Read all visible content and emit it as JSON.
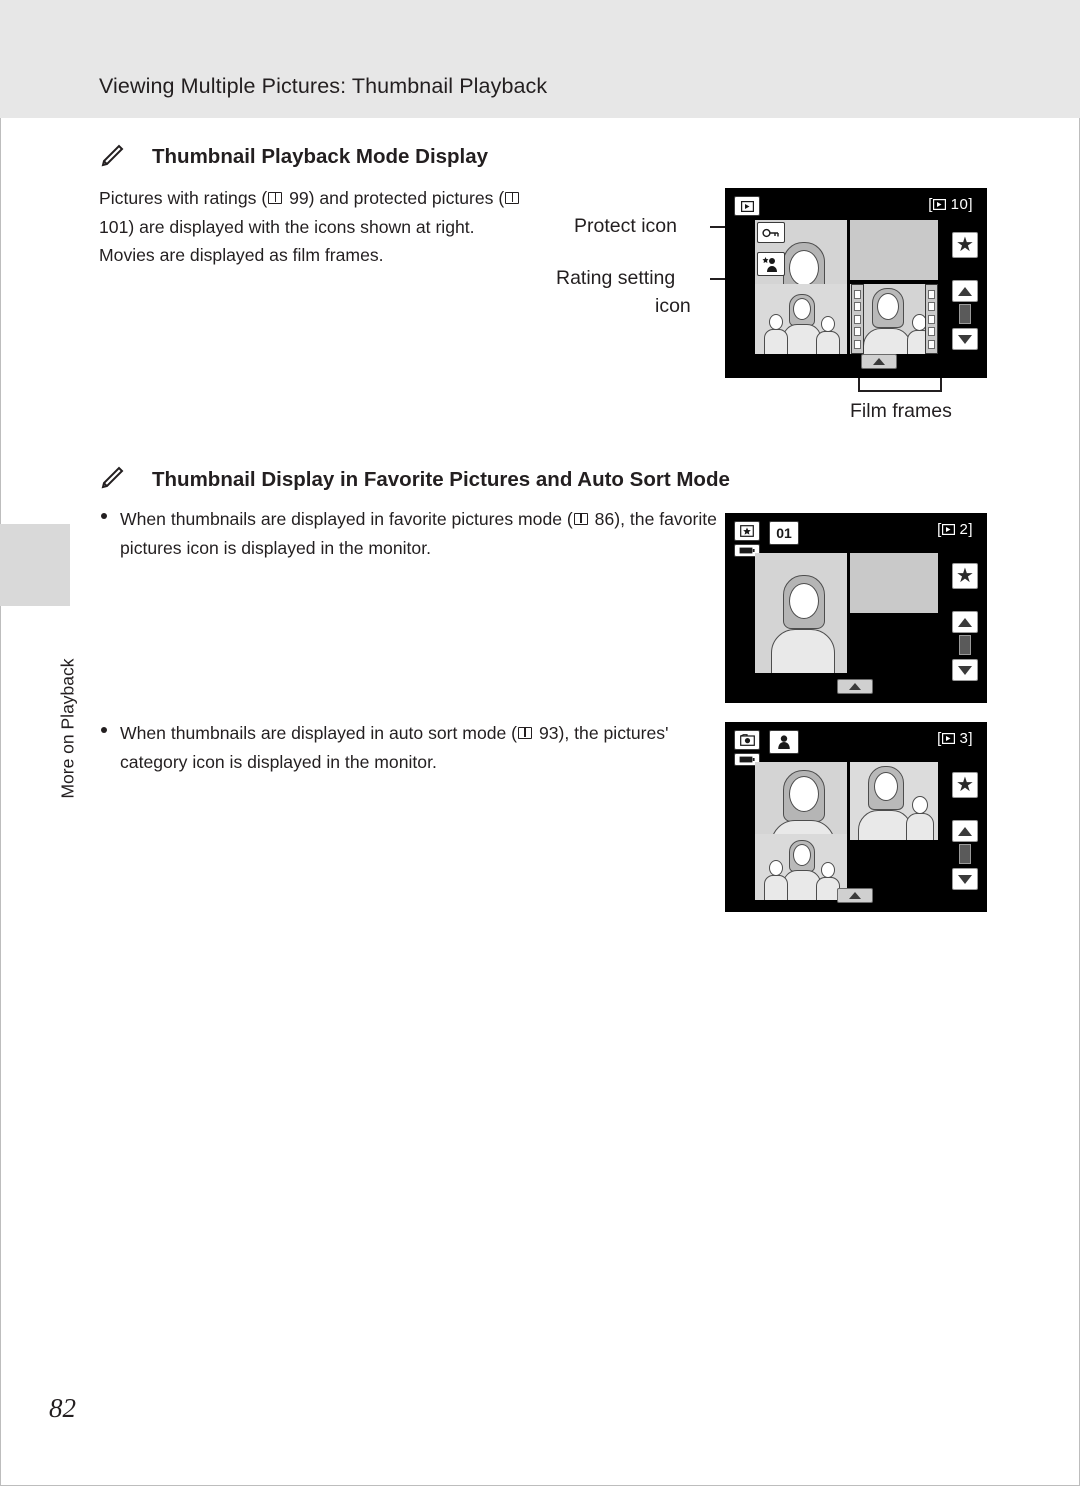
{
  "page": {
    "number": "82",
    "side_tab_label": "More on Playback",
    "header_title": "Viewing Multiple Pictures: Thumbnail Playback"
  },
  "sections": [
    {
      "icon": "pencil-note-icon",
      "heading": "Thumbnail Playback Mode Display",
      "paragraph_lines": [
        "Pictures with ratings (",
        "99) and protected",
        "pictures (",
        "101) are displayed with the icons",
        "shown at right. Movies are displayed as film",
        "frames."
      ],
      "paragraph_refs": [
        "99",
        "101"
      ],
      "callouts": [
        {
          "name": "protect-icon-label",
          "text": "Protect icon"
        },
        {
          "name": "rating-setting-icon-label",
          "text": "Rating setting"
        },
        {
          "name": "rating-setting-icon-label-2",
          "text": "icon"
        },
        {
          "name": "film-frames-label",
          "text": "Film frames"
        }
      ],
      "monitor": {
        "name": "thumbnail-playback-monitor",
        "mode_icon": "playback-icon",
        "frame_counter": "10",
        "frame_counter_prefix": "[",
        "frame_counter_suffix": "]",
        "protect_icon": "key-protect-icon",
        "rating_icon": "rating-star-person-icon",
        "star_button": "star-favorite-icon",
        "scroll_up": "scroll-up-icon",
        "scroll_down": "scroll-down-icon"
      }
    },
    {
      "icon": "pencil-note-icon",
      "heading": "Thumbnail Display in Favorite Pictures and Auto Sort Mode",
      "bullets": [
        {
          "name": "bullet-favorite-pictures",
          "line1_a": "When thumbnails are displayed in favorite pictures mode (",
          "ref": "86",
          "line1_b": "),",
          "line2": "the favorite pictures icon is displayed in the monitor."
        },
        {
          "name": "bullet-auto-sort",
          "line1_a": "When thumbnails are displayed in auto sort mode (",
          "ref": "93",
          "line1_b": "), the",
          "line2": "pictures' category icon is displayed in the monitor."
        }
      ],
      "monitors": [
        {
          "name": "favorite-pictures-monitor",
          "mode_icon": "favorite-pictures-icon",
          "album_number": "01",
          "frame_counter": "2",
          "frame_counter_prefix": "[",
          "frame_counter_suffix": "]",
          "star_button": "star-favorite-icon",
          "scroll_up": "scroll-up-icon",
          "scroll_down": "scroll-down-icon"
        },
        {
          "name": "auto-sort-monitor",
          "mode_icon": "auto-sort-icon",
          "category_icon": "portrait-category-icon",
          "frame_counter": "3",
          "frame_counter_prefix": "[",
          "frame_counter_suffix": "]",
          "star_button": "star-favorite-icon",
          "scroll_up": "scroll-up-icon",
          "scroll_down": "scroll-down-icon"
        }
      ]
    }
  ]
}
